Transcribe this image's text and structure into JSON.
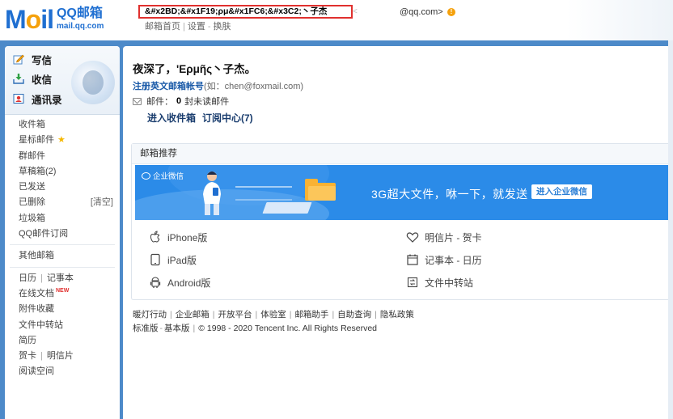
{
  "header": {
    "logo_word": [
      "M",
      "o",
      "il"
    ],
    "logo_cn": "QQ邮箱",
    "logo_domain": "mail.qq.com",
    "user_name": "&#x2BD;&#x1F19;ρμ&#x1FC6;&#x3C2;丶子杰",
    "user_name_suffix": "<",
    "email": "@qq.com>",
    "warn": "!",
    "links": [
      "邮箱首页",
      "设置",
      "换肤"
    ],
    "link_separators": [
      "|",
      "-"
    ]
  },
  "sidebar": {
    "actions": [
      {
        "label": "写信",
        "icon": "pen-icon"
      },
      {
        "label": "收信",
        "icon": "inbox-icon"
      },
      {
        "label": "通讯录",
        "icon": "contacts-icon"
      }
    ],
    "folders": [
      "收件箱",
      "星标邮件",
      "群邮件",
      "草稿箱(2)",
      "已发送",
      "已删除",
      "垃圾箱",
      "QQ邮件订阅"
    ],
    "deleted_extra": "[清空]",
    "star": "★",
    "other": "其他邮箱",
    "tools_row1": [
      "日历",
      "记事本"
    ],
    "tools_sep": "|",
    "online_docs": "在线文档",
    "new_badge": "NEW",
    "tools_rest": [
      "附件收藏",
      "文件中转站",
      "简历"
    ],
    "tools_row_last": [
      "贺卡",
      "明信片"
    ],
    "reading": "阅读空间"
  },
  "main": {
    "greeting": "夜深了，'Ερμῆς丶子杰。",
    "register_link": "注册英文邮箱帐号",
    "register_hint": "(如：chen@foxmail.com)",
    "mail_label": "邮件：",
    "unread_count": "0",
    "unread_label": "封未读邮件",
    "quick_links": [
      "进入收件箱",
      "订阅中心(7)"
    ],
    "recommend_title": "邮箱推荐",
    "banner_brand": "企业微信",
    "banner_slogan": "3G超大文件，咻一下，就发送",
    "banner_button": "进入企业微信",
    "apps": [
      {
        "label": "iPhone版",
        "icon": "apple-icon"
      },
      {
        "label": "明信片 - 贺卡",
        "icon": "heart-icon"
      },
      {
        "label": "iPad版",
        "icon": "tablet-icon"
      },
      {
        "label": "记事本 - 日历",
        "icon": "calendar-icon"
      },
      {
        "label": "Android版",
        "icon": "android-icon"
      },
      {
        "label": "文件中转站",
        "icon": "transfer-icon"
      }
    ],
    "footer_links": [
      "暖灯行动",
      "企业邮箱",
      "开放平台",
      "体验室",
      "邮箱助手",
      "自助查询",
      "隐私政策"
    ],
    "footer_sep": "|",
    "footer_line2": [
      "标准版",
      "基本版"
    ],
    "footer_line2_sep": "-",
    "copyright": "© 1998 - 2020 Tencent Inc. All Rights Reserved"
  }
}
